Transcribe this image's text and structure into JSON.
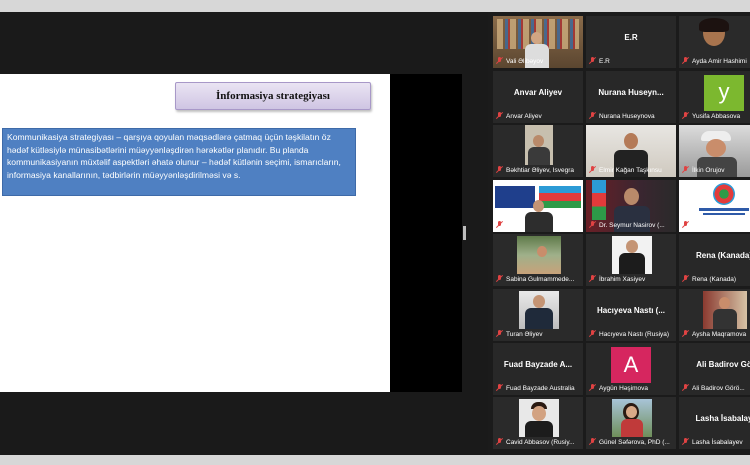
{
  "slide": {
    "title": "İnformasiya strategiyası",
    "body": "Kommunikasiya strategiyası – qarşıya qoyulan məqsədlərə çatmaq üçün təşkilatın öz hədəf kütləsiylə münasibətlərini müəyyənləşdirən hərəkətlər planıdır. Bu planda kommunikasiyanın müxtəlif aspektləri əhatə olunur – hədəf kütlənin seçimi, ismarıcların, informasiya kanallarının, tədbirlərin müəyyənləşdirilməsi və s."
  },
  "participants": [
    {
      "label": "Vali Əlibəyov",
      "display": "",
      "video": true,
      "active": true
    },
    {
      "label": "E.R",
      "display": "E.R",
      "video": false
    },
    {
      "label": "Ayda Amir Hashimi",
      "display": "",
      "video": true
    },
    {
      "label": "Anvar Aliyev",
      "display": "Anvar Aliyev",
      "video": false
    },
    {
      "label": "Nurana Huseynova",
      "display": "Nurana Huseyn...",
      "video": false
    },
    {
      "label": "Yusifa Abbasova",
      "display": "y",
      "avatar": true,
      "avatar_color": "#7cb82f"
    },
    {
      "label": "Bəkhtiar Əliyev, Isvegra",
      "display": "",
      "video": true
    },
    {
      "label": "Elmir Kağan Taşkınsu",
      "display": "",
      "video": true
    },
    {
      "label": "İlkin Orujov",
      "display": "",
      "video": true
    },
    {
      "label": "Eğerb",
      "display": "",
      "video": true
    },
    {
      "label": "Dr. Seymur Nasirov (...",
      "display": "",
      "video": true
    },
    {
      "label": "Diasporal işi üzrə",
      "display": "",
      "video": true
    },
    {
      "label": "Sabina Gulmammede...",
      "display": "",
      "video": true
    },
    {
      "label": "İbrahim Xasiyev",
      "display": "",
      "video": true
    },
    {
      "label": "Rena (Kanada)",
      "display": "Rena (Kanada)",
      "video": false
    },
    {
      "label": "Turan Əliyev",
      "display": "",
      "video": true
    },
    {
      "label": "Hacıyeva Nastı (Rusiya)",
      "display": "Hacıyeva Nastı (...",
      "video": false
    },
    {
      "label": "Aysha Maqramova",
      "display": "",
      "video": true
    },
    {
      "label": "Fuad Bayzade Australia",
      "display": "Fuad Bayzade A...",
      "video": false
    },
    {
      "label": "Aygün Həşimova",
      "display": "A",
      "avatar": true,
      "avatar_color": "#d6265f"
    },
    {
      "label": "Ali Badirov Görö...",
      "display": "Ali Badirov Gö",
      "video": false
    },
    {
      "label": "Cavid Abbasov (Rusiy...",
      "display": "",
      "video": true
    },
    {
      "label": "Günel Səfərova, PhD (...",
      "display": "",
      "video": true
    },
    {
      "label": "Lasha İsabalayev",
      "display": "Lasha İsabalay",
      "video": false
    }
  ]
}
